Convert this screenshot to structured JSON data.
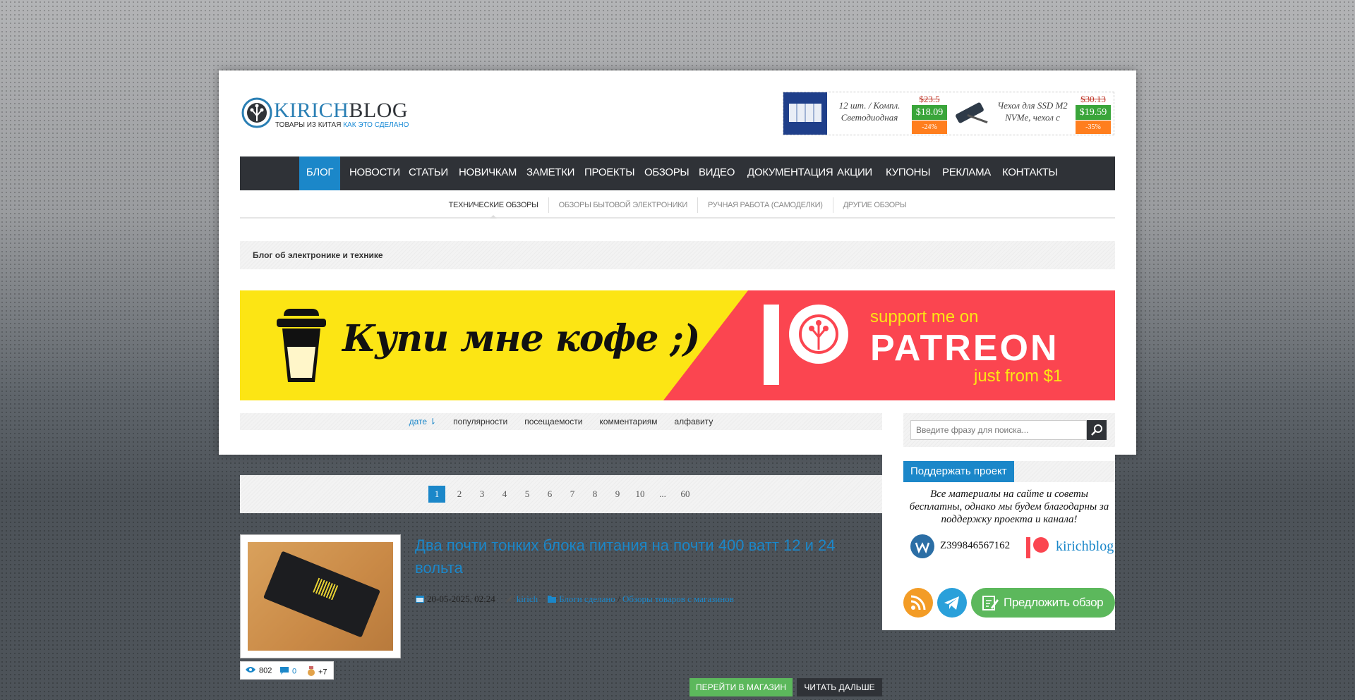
{
  "logo": {
    "word_a": "KIRICH",
    "word_b": "BLOG",
    "sub_a": "ТОВАРЫ ИЗ КИТАЯ",
    "sub_b": "КАК ЭТО СДЕЛАНО"
  },
  "ads": [
    {
      "text": "12 шт. / Компл. Светодиодная",
      "old_price": "$23.5",
      "new_price": "$18.09",
      "discount": "-24%"
    },
    {
      "text": "Чехол для SSD M2 NVMe, чехол с",
      "old_price": "$30.13",
      "new_price": "$19.59",
      "discount": "-35%"
    }
  ],
  "nav": {
    "items": [
      "БЛОГ",
      "НОВОСТИ",
      "СТАТЬИ",
      "НОВИЧКАМ",
      "ЗАМЕТКИ",
      "ПРОЕКТЫ",
      "ОБЗОРЫ",
      "ВИДЕО",
      "ДОКУМЕНТАЦИЯ",
      "АКЦИИ",
      "КУПОНЫ",
      "РЕКЛАМА",
      "КОНТАКТЫ"
    ],
    "active": "БЛОГ"
  },
  "subnav": {
    "items": [
      "ТЕХНИЧЕСКИЕ ОБЗОРЫ",
      "ОБЗОРЫ БЫТОВОЙ ЭЛЕКТРОНИКИ",
      "РУЧНАЯ РАБОТА (САМОДЕЛКИ)",
      "ДРУГИЕ ОБЗОРЫ"
    ],
    "active": "ТЕХНИЧЕСКИЕ ОБЗОРЫ"
  },
  "page_title": "Блог об электронике и технике",
  "banner": {
    "kofe": "Купи мне кофе ;)",
    "support": "support me on",
    "patreon": "PATREON",
    "from": "just from $1"
  },
  "sort": {
    "items": [
      "дате",
      "популярности",
      "посещаемости",
      "комментариям",
      "алфавиту"
    ],
    "active": "дате"
  },
  "search": {
    "placeholder": "Введите фразу для поиска..."
  },
  "pager": {
    "pages": [
      "1",
      "2",
      "3",
      "4",
      "5",
      "6",
      "7",
      "8",
      "9",
      "10",
      "...",
      "60"
    ],
    "current": "1"
  },
  "sidebar": {
    "support_title": "Поддержать проект",
    "support_text": "Все материалы на сайте и советы бесплатны, однако мы будем благодарны за поддержку проекта и канала!",
    "webmoney_id": "Z399846567162",
    "patreon_name": "kirichblog",
    "propose_label": "Предложить обзор"
  },
  "post": {
    "title": "Два почти тонких блока питания на почти 400 ватт 12 и 24 вольта",
    "date": "20-05-2025, 02:24",
    "author": "kirich",
    "category_a": "Блоги сделано",
    "category_sep": " / ",
    "category_b": "Обзоры товаров с магазинов",
    "views": "802",
    "comments": "0",
    "rating": "+7",
    "btn_shop": "ПЕРЕЙТИ В МАГАЗИН",
    "btn_read": "ЧИТАТЬ ДАЛЬШЕ"
  },
  "colors": {
    "accent": "#1b87c9",
    "nav_bg": "#2f3237",
    "green": "#5cb85c",
    "patreon_red": "#fb4550",
    "kofe_yellow": "#fce514"
  }
}
